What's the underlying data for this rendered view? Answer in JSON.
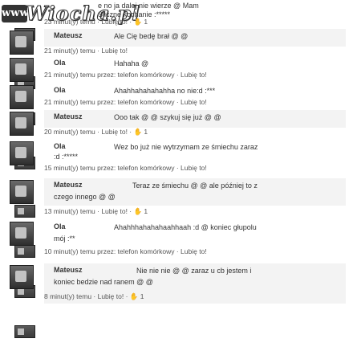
{
  "logo": {
    "prefix": "www.",
    "name": "Wiocha.pl"
  },
  "top_comment": {
    "text_line1": "e no ja dalej nie wierze @ Mam",
    "text_line2": "Sliczne kochanie :*****",
    "meta": "23 minut(y) temu · Lubię to! · ✋ 1"
  },
  "comments": [
    {
      "author": "Mateusz",
      "text": "Ale Cię bedę brał @ @",
      "meta": "21 minut(y) temu · Lubię to!"
    },
    {
      "author": "Ola",
      "text": "Hahaha @",
      "meta": "21 minut(y) temu przez: telefon komórkowy · Lubię to!"
    },
    {
      "author": "Ola",
      "text": "Ahahhahahahahha no nie:d :***",
      "meta": "21 minut(y) temu przez: telefon komórkowy · Lubię to!"
    },
    {
      "author": "Mateusz",
      "text": "Ooo tak @ @ szykuj się już @ @",
      "meta": "20 minut(y) temu · Lubię to! · ✋ 1"
    },
    {
      "author": "Ola",
      "text": "Wez bo już nie wytrzymam ze śmiechu zaraz",
      "text2": ":d :*****",
      "meta": "15 minut(y) temu przez: telefon komórkowy · Lubię to!"
    },
    {
      "author": "Mateusz",
      "text": "Teraz ze śmiechu @ @ ale później to z",
      "text2": "czego innego @ @",
      "meta": "13 minut(y) temu · Lubię to! · ✋ 1"
    },
    {
      "author": "Ola",
      "text": "Ahahhhahahahaahhaah :d @ koniec głupolu",
      "text2": "mój :**",
      "meta": "10 minut(y) temu przez: telefon komórkowy · Lubię to!"
    },
    {
      "author": "Mateusz",
      "text": "Nie nie nie @ @ zaraz u cb jestem i",
      "text2": "koniec bedzie nad ranem @ @",
      "meta": "8 minut(y) temu · Lubię to! · ✋ 1"
    }
  ]
}
